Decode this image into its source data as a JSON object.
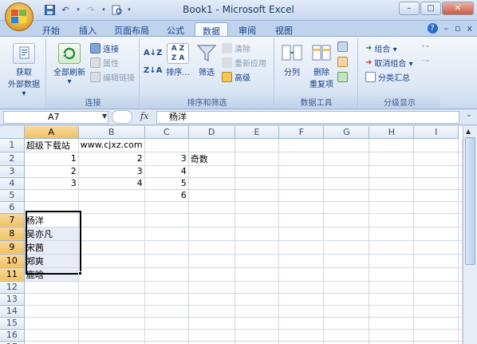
{
  "app": {
    "title": "Book1 - Microsoft Excel"
  },
  "quick_access": {
    "save_icon": "save-icon",
    "undo_icon": "undo-icon",
    "redo_icon": "redo-icon",
    "print_preview_icon": "print-preview-icon"
  },
  "window_controls": {
    "minimize": "–",
    "restore": "□",
    "close": "✕"
  },
  "tabs": [
    {
      "label": "开始"
    },
    {
      "label": "插入"
    },
    {
      "label": "页面布局"
    },
    {
      "label": "公式"
    },
    {
      "label": "数据",
      "active": true
    },
    {
      "label": "审阅"
    },
    {
      "label": "视图"
    }
  ],
  "ribbon_right": {
    "help": "?",
    "minimize": "–",
    "restore": "▫",
    "close": "x"
  },
  "ribbon": {
    "groups": [
      {
        "label": "",
        "big_buttons": [
          {
            "label_line1": "获取",
            "label_line2": "外部数据 ▾"
          }
        ]
      },
      {
        "label": "连接",
        "big_buttons": [
          {
            "label_line1": "全部刷新",
            "label_line2": "▾"
          }
        ],
        "small_buttons": [
          {
            "label": "连接",
            "enabled": true
          },
          {
            "label": "属性",
            "enabled": false
          },
          {
            "label": "编辑链接",
            "enabled": false
          }
        ]
      },
      {
        "label": "排序和筛选",
        "small_buttons": [
          {
            "label": "A↓Z",
            "enabled": true
          },
          {
            "label": "Z↓A",
            "enabled": true
          }
        ],
        "big_buttons": [
          {
            "label_line1": "排序...",
            "label_line2": ""
          },
          {
            "label_line1": "筛选",
            "label_line2": ""
          }
        ],
        "right_buttons": [
          {
            "label": "清除",
            "enabled": false
          },
          {
            "label": "重新应用",
            "enabled": false
          },
          {
            "label": "高级",
            "enabled": true
          }
        ]
      },
      {
        "label": "数据工具",
        "big_buttons": [
          {
            "label_line1": "分列",
            "label_line2": ""
          },
          {
            "label_line1": "删除",
            "label_line2": "重复项"
          }
        ]
      },
      {
        "label": "分级显示",
        "small_buttons": [
          {
            "label": "组合 ▾",
            "enabled": true
          },
          {
            "label": "取消组合 ▾",
            "enabled": true
          },
          {
            "label": "分类汇总",
            "enabled": true
          }
        ]
      }
    ]
  },
  "formula_bar": {
    "name_box": "A7",
    "fx": "fx",
    "content": "杨洋"
  },
  "sheet": {
    "columns": [
      "A",
      "B",
      "C",
      "D",
      "E",
      "F",
      "G",
      "H",
      "I"
    ],
    "rows": [
      [
        "超级下载站",
        "www.cjxz.com",
        "",
        "",
        "",
        "",
        "",
        "",
        ""
      ],
      [
        "1",
        "2",
        "3",
        "奇数",
        "",
        "",
        "",
        "",
        ""
      ],
      [
        "2",
        "3",
        "4",
        "",
        "",
        "",
        "",
        "",
        ""
      ],
      [
        "3",
        "4",
        "5",
        "",
        "",
        "",
        "",
        "",
        ""
      ],
      [
        "",
        "",
        "6",
        "",
        "",
        "",
        "",
        "",
        ""
      ],
      [
        "",
        "",
        "",
        "",
        "",
        "",
        "",
        "",
        ""
      ],
      [
        "杨洋",
        "",
        "",
        "",
        "",
        "",
        "",
        "",
        ""
      ],
      [
        "吴亦凡",
        "",
        "",
        "",
        "",
        "",
        "",
        "",
        ""
      ],
      [
        "宋茜",
        "",
        "",
        "",
        "",
        "",
        "",
        "",
        ""
      ],
      [
        "郑爽",
        "",
        "",
        "",
        "",
        "",
        "",
        "",
        ""
      ],
      [
        "鹿晗",
        "",
        "",
        "",
        "",
        "",
        "",
        "",
        ""
      ],
      [
        "",
        "",
        "",
        "",
        "",
        "",
        "",
        "",
        ""
      ],
      [
        "",
        "",
        "",
        "",
        "",
        "",
        "",
        "",
        ""
      ],
      [
        "",
        "",
        "",
        "",
        "",
        "",
        "",
        "",
        ""
      ],
      [
        "",
        "",
        "",
        "",
        "",
        "",
        "",
        "",
        ""
      ],
      [
        "",
        "",
        "",
        "",
        "",
        "",
        "",
        "",
        ""
      ],
      [
        "",
        "",
        "",
        "",
        "",
        "",
        "",
        "",
        ""
      ]
    ],
    "selected_column": "A",
    "selected_rows": [
      "7",
      "8",
      "9",
      "10",
      "11"
    ]
  }
}
